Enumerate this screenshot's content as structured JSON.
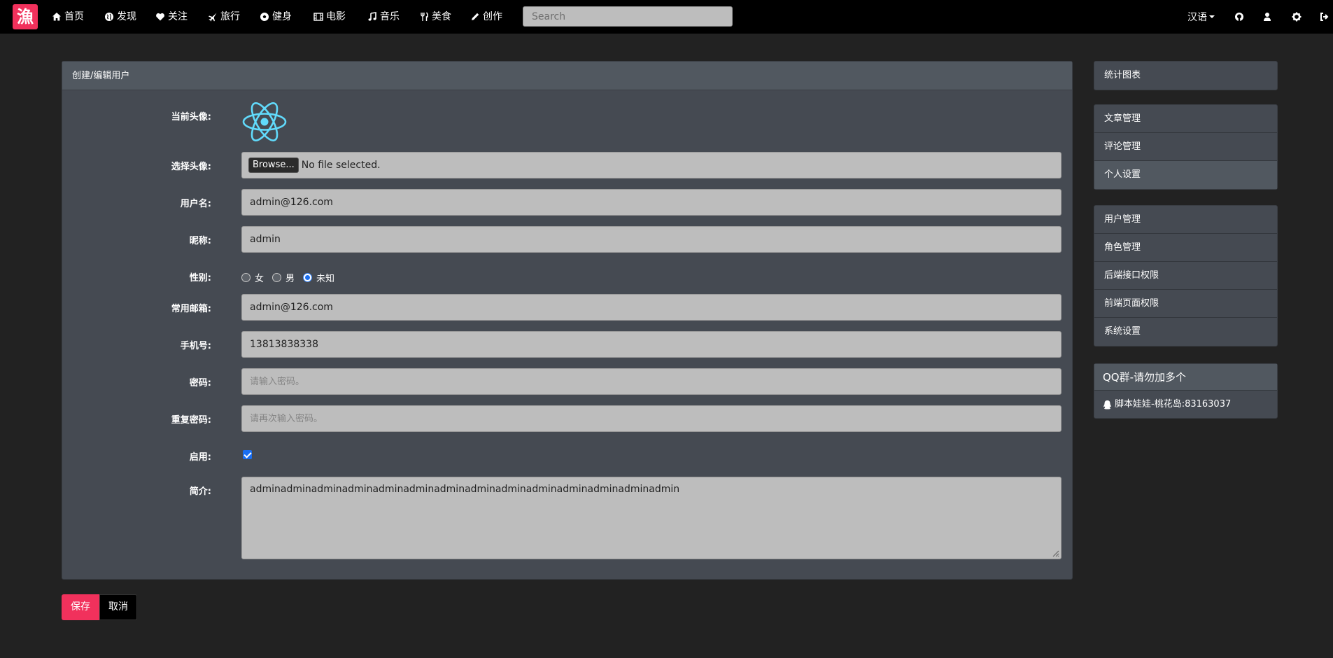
{
  "nav": {
    "logo": "漁",
    "items": [
      {
        "label": "首页",
        "icon": "home-icon"
      },
      {
        "label": "发现",
        "icon": "globe-icon"
      },
      {
        "label": "关注",
        "icon": "heart-icon"
      },
      {
        "label": "旅行",
        "icon": "plane-icon"
      },
      {
        "label": "健身",
        "icon": "soccer-ball-icon"
      },
      {
        "label": "电影",
        "icon": "film-icon"
      },
      {
        "label": "音乐",
        "icon": "music-icon"
      },
      {
        "label": "美食",
        "icon": "cutlery-icon"
      },
      {
        "label": "创作",
        "icon": "pencil-icon"
      }
    ],
    "search_placeholder": "Search",
    "language": "汉语"
  },
  "panel": {
    "title": "创建/编辑用户",
    "labels": {
      "avatar_current": "当前头像:",
      "avatar_select": "选择头像:",
      "username": "用户名:",
      "nickname": "昵称:",
      "gender": "性别:",
      "email": "常用邮箱:",
      "phone": "手机号:",
      "password": "密码:",
      "password_repeat": "重复密码:",
      "enabled": "启用:",
      "bio": "简介:"
    },
    "file": {
      "button": "Browse...",
      "status": "No file selected."
    },
    "username_value": "admin@126.com",
    "nickname_value": "admin",
    "gender_options": [
      "女",
      "男",
      "未知"
    ],
    "gender_selected": "未知",
    "email_value": "admin@126.com",
    "phone_value": "13813838338",
    "password_placeholder": "请输入密码。",
    "password_repeat_placeholder": "请再次输入密码。",
    "enabled": true,
    "bio_value": "adminadminadminadminadminadminadminadminadminadminadminadminadminadmin"
  },
  "actions": {
    "save": "保存",
    "cancel": "取消"
  },
  "sidebar": {
    "group1": [
      "统计图表"
    ],
    "group2": [
      "文章管理",
      "评论管理",
      "个人设置"
    ],
    "group3": [
      "用户管理",
      "角色管理",
      "后端接口权限",
      "前端页面权限",
      "系统设置"
    ],
    "qq": {
      "title": "QQ群-请勿加多个",
      "entry": "脚本娃娃-桃花岛:83163037"
    }
  },
  "colors": {
    "brand": "#f1315c",
    "react_logo": "#61dafb",
    "navbar": "#000000",
    "panel": "#454a52"
  }
}
